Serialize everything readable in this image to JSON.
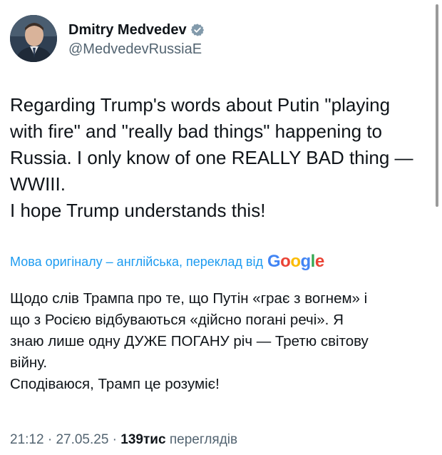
{
  "author": {
    "display_name": "Dmitry Medvedev",
    "handle": "@MedvedevRussiaE",
    "verified_icon": "verified-badge-icon",
    "badge_color": "#829aab"
  },
  "tweet": {
    "lines": [
      "Regarding Trump's words about Putin \"playing",
      "with fire\" and \"really bad things\" happening to",
      "Russia. I only know of one REALLY BAD thing —",
      "WWIII.",
      "I hope Trump understands this!"
    ]
  },
  "translation": {
    "label": "Мова оригіналу – англійська, переклад від",
    "provider": "Google",
    "lines": [
      "Щодо слів Трампа про те, що Путін «грає з вогнем» і",
      "що з Росією відбуваються «дійсно погані речі». Я",
      "знаю лише одну ДУЖЕ ПОГАНУ річ — Третю світову",
      "війну.",
      "Сподіваюся, Трамп це розуміє!"
    ],
    "link_color": "#1d9bf0"
  },
  "meta": {
    "time": "21:12",
    "separator": " · ",
    "date": "27.05.25",
    "views_count": "139тис",
    "views_label": "переглядів"
  }
}
